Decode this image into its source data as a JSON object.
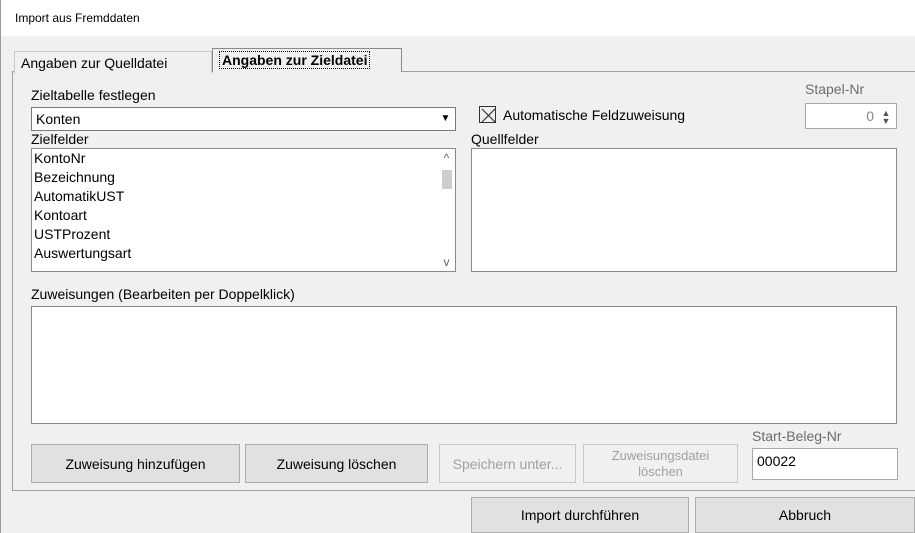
{
  "window": {
    "title": "Import aus Fremddaten"
  },
  "tabs": [
    {
      "label": "Angaben zur Quelldatei",
      "active": false
    },
    {
      "label": "Angaben zur Zieldatei",
      "active": true
    }
  ],
  "zieltabelle": {
    "label": "Zieltabelle festlegen",
    "value": "Konten"
  },
  "auto_zuweisung": {
    "label": "Automatische Feldzuweisung",
    "checked": true
  },
  "stapel": {
    "label": "Stapel-Nr",
    "value": "0"
  },
  "zielfelder": {
    "label": "Zielfelder",
    "items": [
      "KontoNr",
      "Bezeichnung",
      "AutomatikUST",
      "Kontoart",
      "USTProzent",
      "Auswertungsart"
    ]
  },
  "quellfelder": {
    "label": "Quellfelder",
    "items": []
  },
  "zuweisungen": {
    "label": "Zuweisungen (Bearbeiten per Doppelklick)"
  },
  "buttons": {
    "add": "Zuweisung hinzufügen",
    "delete": "Zuweisung löschen",
    "save_as": "Speichern unter...",
    "delete_file": "Zuweisungsdatei löschen",
    "import": "Import durchführen",
    "cancel": "Abbruch"
  },
  "start_beleg": {
    "label": "Start-Beleg-Nr",
    "value": "00022"
  },
  "icons": {
    "combo_arrow": "chevron-down-icon",
    "spin": "spin-arrows-icon",
    "scroll_up": "arrow-up-icon",
    "scroll_down": "arrow-down-icon"
  }
}
